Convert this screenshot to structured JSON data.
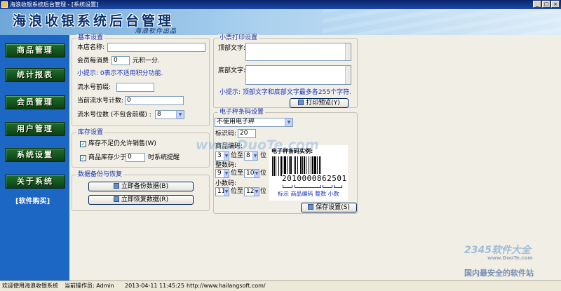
{
  "window": {
    "title": "海浪收银系统后台管理 - [系统设置]",
    "buttons": [
      "_",
      "□",
      "×"
    ]
  },
  "header": {
    "title": "海浪收银系统后台管理",
    "subtitle": "海浪软件出品"
  },
  "sidebar": {
    "items": [
      "商品管理",
      "统计报表",
      "会员管理",
      "用户管理",
      "系统设置",
      "关于系统"
    ],
    "link": "[软件购买]"
  },
  "basic": {
    "title": "基本设置",
    "store_name_label": "本店名称:",
    "store_name_value": "",
    "points_label": "会员每消费",
    "points_value": "0",
    "points_suffix": "元积一分.",
    "hint": "小提示: 0表示不适用积分功能.",
    "serial_prefix_label": "流水号前缀:",
    "serial_prefix_value": "",
    "serial_count_label": "当前流水号计数:",
    "serial_count_value": "0",
    "serial_digits_label": "流水号位数 (不包含前缀) :",
    "serial_digits_value": "8"
  },
  "stock": {
    "title": "库存设置",
    "allow_label": "库存不足仍允许销售(W)",
    "warn_label": "商品库存少于",
    "warn_value": "0",
    "warn_suffix": "时系统提醒"
  },
  "backup": {
    "title": "数据备份与恢复",
    "backup_button": "立即备份数据(B)",
    "restore_button": "立即恢复数据(R)"
  },
  "receipt": {
    "title": "小票打印设置",
    "top_label": "顶部文字:",
    "bottom_label": "底部文字:",
    "hint": "小提示: 顶部文字和底部文字最多各255个字符.",
    "preview_button": "打印预览(Y)"
  },
  "scale": {
    "title": "电子秤条码设置",
    "mode": "不使用电子秤",
    "id_label": "标识码:",
    "id_value": "20",
    "goods_label": "商品编码:",
    "goods_from": "3",
    "goods_to": "8",
    "int_label": "整数码:",
    "int_from": "9",
    "int_to": "10",
    "dec_label": "小数码:",
    "dec_from": "11",
    "dec_to": "12",
    "from_text": "位至",
    "to_text": "位",
    "example_caption": "电子秤条码实例:",
    "example_number": "2010000862501",
    "legend": "标示 商品编码 整数 小数",
    "save_button": "保存设置(S)"
  },
  "status": {
    "welcome": "欢迎使用海浪收银系统",
    "operator": "当前操作员: Admin",
    "time": "2013-04-11 11:45:25",
    "url": "http://www.hailangsoft.com/"
  },
  "watermarks": {
    "site": "www.DuoTe.com",
    "brand": "2345软件大全",
    "brand_url": "www.DuoTe.com",
    "slogan": "国内最安全的软件站"
  }
}
